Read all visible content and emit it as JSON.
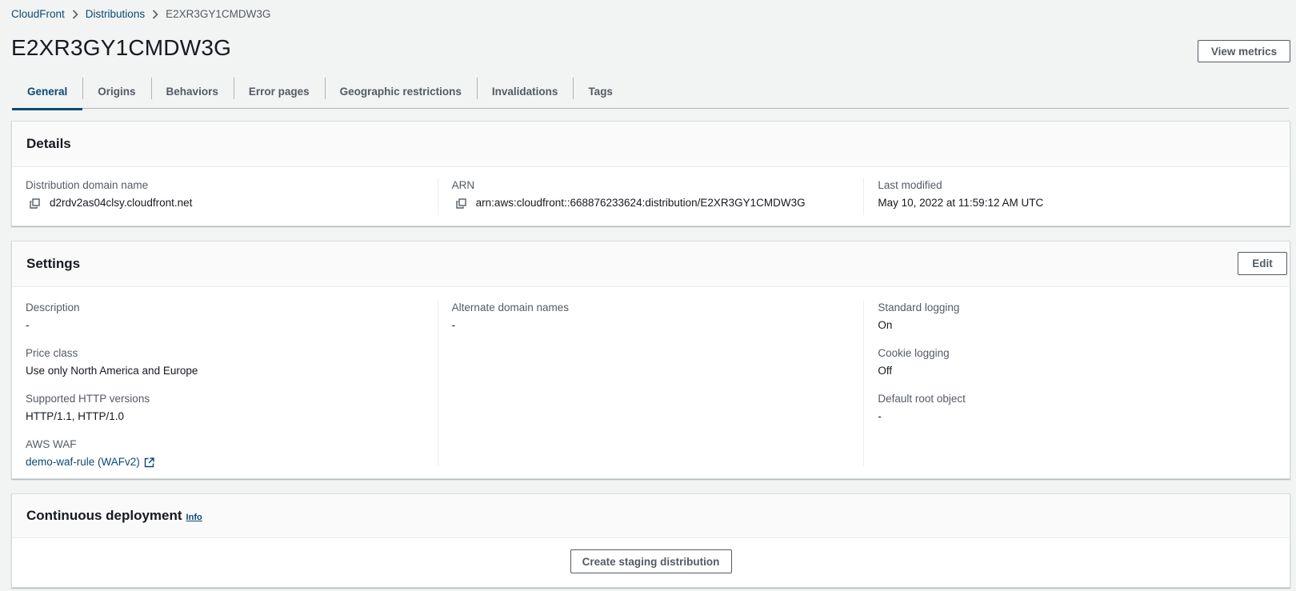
{
  "breadcrumb": {
    "items": [
      "CloudFront",
      "Distributions"
    ],
    "current": "E2XR3GY1CMDW3G"
  },
  "page": {
    "title": "E2XR3GY1CMDW3G",
    "view_metrics_label": "View metrics"
  },
  "tabs": [
    {
      "label": "General",
      "active": true
    },
    {
      "label": "Origins"
    },
    {
      "label": "Behaviors"
    },
    {
      "label": "Error pages"
    },
    {
      "label": "Geographic restrictions"
    },
    {
      "label": "Invalidations"
    },
    {
      "label": "Tags"
    }
  ],
  "details": {
    "title": "Details",
    "domain_label": "Distribution domain name",
    "domain_value": "d2rdv2as04clsy.cloudfront.net",
    "arn_label": "ARN",
    "arn_value": "arn:aws:cloudfront::668876233624:distribution/E2XR3GY1CMDW3G",
    "modified_label": "Last modified",
    "modified_value": "May 10, 2022 at 11:59:12 AM UTC"
  },
  "settings": {
    "title": "Settings",
    "edit_label": "Edit",
    "description_label": "Description",
    "description_value": "-",
    "price_class_label": "Price class",
    "price_class_value": "Use only North America and Europe",
    "http_label": "Supported HTTP versions",
    "http_value": "HTTP/1.1, HTTP/1.0",
    "waf_label": "AWS WAF",
    "waf_value": "demo-waf-rule (WAFv2)",
    "alt_domains_label": "Alternate domain names",
    "alt_domains_value": "-",
    "std_logging_label": "Standard logging",
    "std_logging_value": "On",
    "cookie_logging_label": "Cookie logging",
    "cookie_logging_value": "Off",
    "root_object_label": "Default root object",
    "root_object_value": "-"
  },
  "continuous": {
    "title": "Continuous deployment",
    "info_label": "Info",
    "create_label": "Create staging distribution"
  },
  "colors": {
    "link": "#0a4a74",
    "text": "#16191f",
    "muted": "#545b64",
    "background": "#f2f3f3"
  },
  "icons": [
    "chevron-right-icon",
    "copy-icon",
    "external-link-icon"
  ]
}
